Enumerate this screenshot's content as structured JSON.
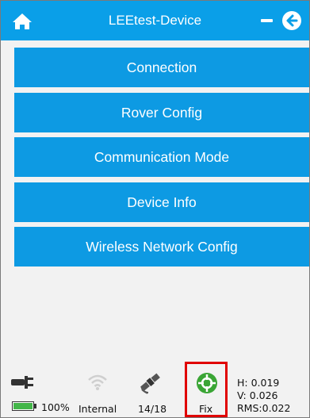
{
  "header": {
    "title": "LEEtest-Device",
    "home_icon": "home-icon",
    "minimize_icon": "minimize-icon",
    "back_icon": "back-arrow-icon"
  },
  "menu": {
    "items": [
      {
        "label": "Connection"
      },
      {
        "label": "Rover Config"
      },
      {
        "label": "Communication Mode"
      },
      {
        "label": "Device Info"
      },
      {
        "label": "Wireless Network Config"
      }
    ]
  },
  "status": {
    "battery_percent": "100%",
    "battery_icon": "battery-icon",
    "power_plug_icon": "power-plug-icon",
    "wifi_icon": "wifi-icon",
    "network_mode": "Internal",
    "satellite_icon": "satellite-icon",
    "satellites": "14/18",
    "fix_icon": "gnss-fix-icon",
    "fix_status": "Fix",
    "h_precision": "H:  0.019",
    "v_precision": "V:  0.026",
    "rms": "RMS:0.022"
  },
  "colors": {
    "header_bg": "#0a9fe8",
    "button_bg": "#0d9ae3",
    "background": "#f2f2f2",
    "fix_green": "#3aa535",
    "highlight_red": "#e00000",
    "battery_green": "#43b649"
  }
}
